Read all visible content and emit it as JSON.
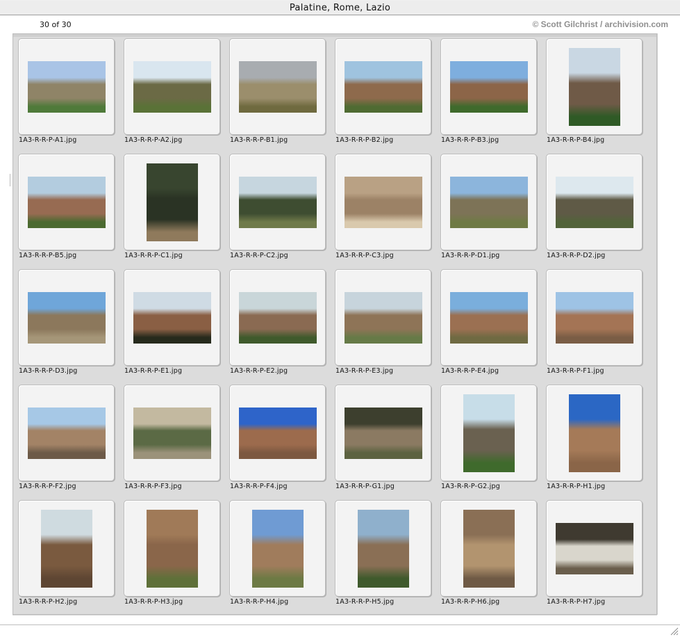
{
  "window": {
    "title": "Palatine, Rome, Lazio",
    "count_text": "30 of 30",
    "credit": "© Scott Gilchrist / archivision.com"
  },
  "thumbnails": [
    {
      "name": "1A3-R-R-P-A1.jpg",
      "orientation": "landscape",
      "colors": [
        "#a9c4e6",
        "#8f8467",
        "#4f7a3a"
      ]
    },
    {
      "name": "1A3-R-R-P-A2.jpg",
      "orientation": "landscape",
      "colors": [
        "#d9e6ef",
        "#6b6a45",
        "#5a7237"
      ]
    },
    {
      "name": "1A3-R-R-P-B1.jpg",
      "orientation": "landscape",
      "colors": [
        "#a8acb0",
        "#9b8e6c",
        "#6f6a3f"
      ]
    },
    {
      "name": "1A3-R-R-P-B2.jpg",
      "orientation": "landscape",
      "colors": [
        "#9fc3df",
        "#8e6a4c",
        "#4f6b32"
      ]
    },
    {
      "name": "1A3-R-R-P-B3.jpg",
      "orientation": "landscape",
      "colors": [
        "#7eaede",
        "#8c6548",
        "#3f6a2c"
      ]
    },
    {
      "name": "1A3-R-R-P-B4.jpg",
      "orientation": "portrait",
      "colors": [
        "#c9d7e3",
        "#6f5a47",
        "#2f5a26"
      ]
    },
    {
      "name": "1A3-R-R-P-B5.jpg",
      "orientation": "landscape",
      "colors": [
        "#b3ccdf",
        "#976b52",
        "#4b6a30"
      ]
    },
    {
      "name": "1A3-R-R-P-C1.jpg",
      "orientation": "portrait",
      "colors": [
        "#38452f",
        "#2a3324",
        "#8f7a5c"
      ]
    },
    {
      "name": "1A3-R-R-P-C2.jpg",
      "orientation": "landscape",
      "colors": [
        "#c6d6df",
        "#3e4d31",
        "#6f7a4a"
      ]
    },
    {
      "name": "1A3-R-R-P-C3.jpg",
      "orientation": "landscape",
      "colors": [
        "#b9a184",
        "#9c8266",
        "#d9c9ad"
      ]
    },
    {
      "name": "1A3-R-R-P-D1.jpg",
      "orientation": "landscape",
      "colors": [
        "#8cb5dc",
        "#7d7357",
        "#6f7a45"
      ]
    },
    {
      "name": "1A3-R-R-P-D2.jpg",
      "orientation": "landscape",
      "colors": [
        "#dde8ee",
        "#5f5a46",
        "#52633a"
      ]
    },
    {
      "name": "1A3-R-R-P-D3.jpg",
      "orientation": "landscape",
      "colors": [
        "#6fa6d9",
        "#8c785c",
        "#a59678"
      ]
    },
    {
      "name": "1A3-R-R-P-E1.jpg",
      "orientation": "landscape",
      "colors": [
        "#cfdbe4",
        "#8a5f44",
        "#262a1c"
      ]
    },
    {
      "name": "1A3-R-R-P-E2.jpg",
      "orientation": "landscape",
      "colors": [
        "#c9d6d9",
        "#8a6a52",
        "#3f5a2c"
      ]
    },
    {
      "name": "1A3-R-R-P-E3.jpg",
      "orientation": "landscape",
      "colors": [
        "#c7d4dc",
        "#8e7457",
        "#667a47"
      ]
    },
    {
      "name": "1A3-R-R-P-E4.jpg",
      "orientation": "landscape",
      "colors": [
        "#7aaedc",
        "#9b7052",
        "#6f6a42"
      ]
    },
    {
      "name": "1A3-R-R-P-F1.jpg",
      "orientation": "landscape",
      "colors": [
        "#9ec3e5",
        "#a47455",
        "#7a5d45"
      ]
    },
    {
      "name": "1A3-R-R-P-F2.jpg",
      "orientation": "landscape",
      "colors": [
        "#a6c8e6",
        "#a38366",
        "#6d5a48"
      ]
    },
    {
      "name": "1A3-R-R-P-F3.jpg",
      "orientation": "landscape",
      "colors": [
        "#c3b9a0",
        "#5b6a45",
        "#9b927a"
      ]
    },
    {
      "name": "1A3-R-R-P-F4.jpg",
      "orientation": "landscape",
      "colors": [
        "#2e64c9",
        "#9c6b4d",
        "#7c5840"
      ]
    },
    {
      "name": "1A3-R-R-P-G1.jpg",
      "orientation": "landscape",
      "colors": [
        "#3d3f2e",
        "#8b7a62",
        "#5c6240"
      ]
    },
    {
      "name": "1A3-R-R-P-G2.jpg",
      "orientation": "portrait",
      "colors": [
        "#c7dde8",
        "#6a6150",
        "#3f6a2c"
      ]
    },
    {
      "name": "1A3-R-R-P-H1.jpg",
      "orientation": "portrait",
      "colors": [
        "#2b67c4",
        "#a57a58",
        "#8a6548"
      ]
    },
    {
      "name": "1A3-R-R-P-H2.jpg",
      "orientation": "portrait",
      "colors": [
        "#cfdbe0",
        "#7a5a3f",
        "#5e4633"
      ]
    },
    {
      "name": "1A3-R-R-P-H3.jpg",
      "orientation": "portrait",
      "colors": [
        "#a07a58",
        "#8a664a",
        "#5f7039"
      ]
    },
    {
      "name": "1A3-R-R-P-H4.jpg",
      "orientation": "portrait",
      "colors": [
        "#6f9bd3",
        "#a07c5c",
        "#6d7a44"
      ]
    },
    {
      "name": "1A3-R-R-P-H5.jpg",
      "orientation": "portrait",
      "colors": [
        "#8fb0cc",
        "#8a6f55",
        "#3f5a2c"
      ]
    },
    {
      "name": "1A3-R-R-P-H6.jpg",
      "orientation": "portrait",
      "colors": [
        "#8a6f55",
        "#b2946f",
        "#6f5a45"
      ]
    },
    {
      "name": "1A3-R-R-P-H7.jpg",
      "orientation": "landscape",
      "colors": [
        "#3f3a30",
        "#d9d6cc",
        "#6a5e4c"
      ]
    }
  ]
}
